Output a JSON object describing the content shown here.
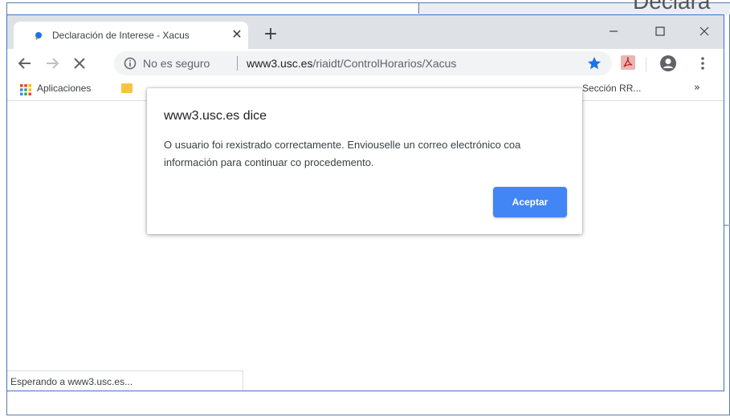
{
  "background_window": {
    "title": "Declara"
  },
  "tab": {
    "title": "Declaración de Interese - Xacus"
  },
  "window_controls": {
    "minimize": "—",
    "maximize": "☐",
    "close": "✕"
  },
  "omnibox": {
    "security_text": "No es seguro",
    "url_domain": "www3.usc.es",
    "url_path": "/riaidt/ControlHorarios/Xacus"
  },
  "bookmarks": {
    "apps_label": "Aplicaciones",
    "right_item": "Sección RR...",
    "more": "»"
  },
  "dialog": {
    "title": "www3.usc.es dice",
    "message": "O usuario foi rexistrado correctamente. Enviouselle un correo electrónico coa información para continuar co procedemento.",
    "ok_label": "Aceptar"
  },
  "statusbar": {
    "text": "Esperando a www3.usc.es..."
  },
  "colors": {
    "accent": "#4285f4",
    "tabstrip": "#dee1e6",
    "window_border": "#3b73c4"
  }
}
